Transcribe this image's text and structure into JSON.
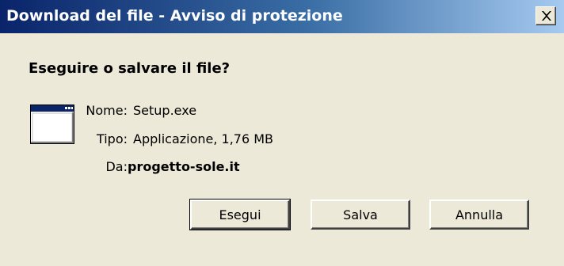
{
  "dialog": {
    "title": "Download del file - Avviso di protezione",
    "question": "Eseguire o salvare il file?",
    "app_icon": "application-window-icon",
    "close_icon": "close-icon"
  },
  "file_info": {
    "name_label": "Nome:",
    "name_value": "Setup.exe",
    "type_label": "Tipo:",
    "type_value": "Applicazione, 1,76 MB",
    "from_label": "Da:",
    "from_value": "progetto-sole.it"
  },
  "buttons": {
    "run": "Esegui",
    "save": "Salva",
    "cancel": "Annulla"
  },
  "colors": {
    "title_gradient_start": "#0a246a",
    "title_gradient_end": "#a6caf0",
    "dialog_background": "#ece9d8"
  }
}
